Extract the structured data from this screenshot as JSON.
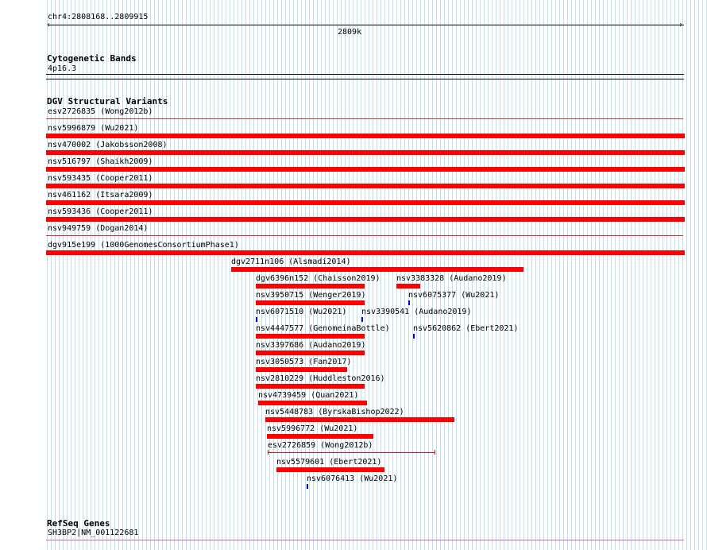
{
  "ruler": {
    "position": "chr4:2808168..2809915",
    "center_label": "2809k"
  },
  "cytobands": {
    "title": "Cytogenetic Bands",
    "band": "4p16.3"
  },
  "dgv": {
    "title": "DGV Structural Variants",
    "full_rows": [
      "esv2726835 (Wong2012b)",
      "nsv5996879 (Wu2021)",
      "nsv470002 (Jakobsson2008)",
      "nsv516797 (Shaikh2009)",
      "nsv593435 (Cooper2011)",
      "nsv461162 (Itsara2009)",
      "nsv593436 (Cooper2011)",
      "nsv949759 (Dogan2014)",
      "dgv915e199 (1000GenomesConsortiumPhase1)"
    ],
    "items": [
      "dgv2711n106 (Alsmadi2014)",
      "dgv6396n152 (Chaisson2019)",
      "nsv3383328 (Audano2019)",
      "nsv3950715 (Wenger2019)",
      "nsv6075377 (Wu2021)",
      "nsv6071510 (Wu2021)",
      "nsv3390541 (Audano2019)",
      "nsv4447577 (GenomeinaBottle)",
      "nsv5620862 (Ebert2021)",
      "nsv3397686 (Audano2019)",
      "nsv3050573 (Fan2017)",
      "nsv2810229 (Huddleston2016)",
      "nsv4739459 (Quan2021)",
      "nsv5448783 (ByrskaBishop2022)",
      "nsv5996772 (Wu2021)",
      "esv2726859 (Wong2012b)",
      "nsv5579601 (Ebert2021)",
      "nsv6076413 (Wu2021)"
    ]
  },
  "refseq": {
    "title": "RefSeq Genes",
    "gene": "SH3BP2|NM_001122681"
  },
  "colors": {
    "variant": "#ff0000",
    "small_variant": "#0000cc",
    "gene_line": "#cc66cc",
    "grid": "#bfe0ec"
  }
}
